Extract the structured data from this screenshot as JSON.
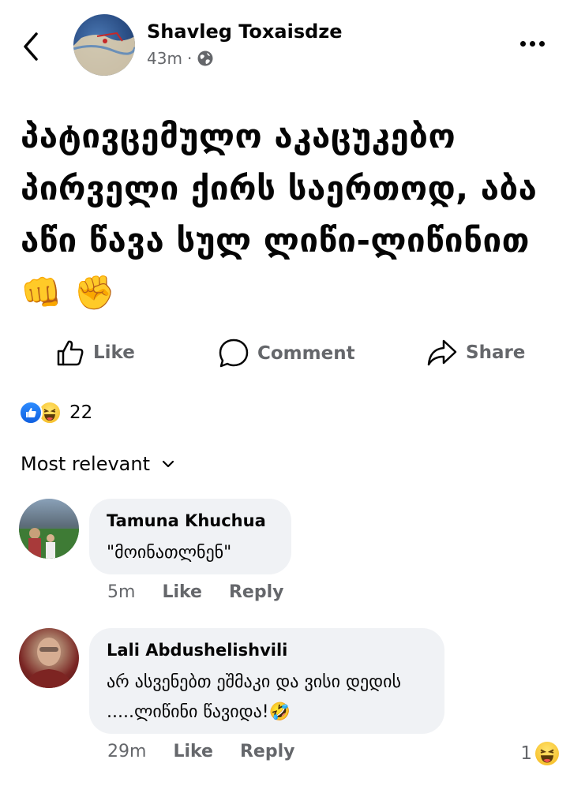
{
  "post": {
    "author": "Shavleg Toxaisdze",
    "time": "43m",
    "separator": "·",
    "text": "პატივცემულო აკაცუკებო პირველი ქირს საერთოდ, აბა აწი წავა სულ ლიწი-ლიწინით👊 ✊"
  },
  "actions": {
    "like": "Like",
    "comment": "Comment",
    "share": "Share"
  },
  "reactions": {
    "count": "22"
  },
  "sort": {
    "label": "Most relevant"
  },
  "comments": [
    {
      "author": "Tamuna Khuchua",
      "text": "\"მოინათლნენ\"",
      "time": "5m",
      "like": "Like",
      "reply": "Reply"
    },
    {
      "author": "Lali Abdushelishvili",
      "text": "არ ასვენებთ ეშმაკი და ვისი დედის .....ლიწინი წავიდა!🤣",
      "time": "29m",
      "like": "Like",
      "reply": "Reply",
      "reaction_count": "1"
    }
  ]
}
